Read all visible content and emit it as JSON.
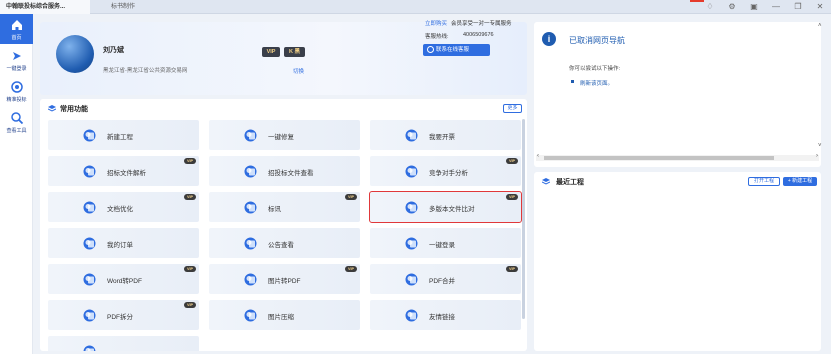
{
  "titlebar": {
    "tabs": [
      {
        "label": "中翰联投标综合服务..."
      },
      {
        "label": "标书制作"
      }
    ],
    "icons": [
      "bell-icon",
      "gear-icon",
      "screenshot-icon",
      "minimize-icon",
      "restore-icon",
      "close-icon"
    ],
    "icon_glyphs": [
      "♢",
      "⚙",
      "▣",
      "—",
      "❐",
      "✕"
    ]
  },
  "nav": {
    "items": [
      {
        "label": "首页",
        "active": true,
        "icon": "home-icon"
      },
      {
        "label": "一键登录",
        "active": false,
        "icon": "login-icon"
      },
      {
        "label": "精准投标",
        "active": false,
        "icon": "target-icon"
      },
      {
        "label": "查看工具",
        "active": false,
        "icon": "search-icon"
      }
    ]
  },
  "user": {
    "name": "刘乃斌",
    "org": "黑龙江省-黑龙江省公共资源交易网",
    "vip_label": "VIP",
    "k_label": "K 黑",
    "switch_label": "切换",
    "buy_now": "立即购买",
    "buy_text": "会员享受一对一专属服务",
    "hotline_label": "客服热线:",
    "hotline_number": "4006509676",
    "contact_button": "联系在线客服"
  },
  "functions": {
    "title": "常用功能",
    "more_label": "更多",
    "vip_text": "VIP",
    "items": [
      {
        "label": "新建工程",
        "vip": false
      },
      {
        "label": "一键修复",
        "vip": false
      },
      {
        "label": "我要开票",
        "vip": false
      },
      {
        "label": "招标文件解析",
        "vip": true
      },
      {
        "label": "招投标文件查看",
        "vip": false
      },
      {
        "label": "竞争对手分析",
        "vip": true
      },
      {
        "label": "文档优化",
        "vip": true
      },
      {
        "label": "标讯",
        "vip": true
      },
      {
        "label": "多版本文件比对",
        "vip": true,
        "highlighted": true
      },
      {
        "label": "我的订单",
        "vip": false
      },
      {
        "label": "公告查看",
        "vip": false
      },
      {
        "label": "一键登录",
        "vip": false
      },
      {
        "label": "Word转PDF",
        "vip": true
      },
      {
        "label": "图片转PDF",
        "vip": true
      },
      {
        "label": "PDF合并",
        "vip": true
      },
      {
        "label": "PDF拆分",
        "vip": true
      },
      {
        "label": "图片压缩",
        "vip": false
      },
      {
        "label": "友情链接",
        "vip": false
      },
      {
        "label": "",
        "vip": false
      }
    ]
  },
  "browser_panel": {
    "title": "已取消网页导航",
    "subtitle": "你可以尝试以下操作:",
    "link": "刷新该页面。"
  },
  "recent": {
    "title": "最近工程",
    "open_label": "打开工程",
    "new_label": "+ 新建工程"
  },
  "colors": {
    "accent": "#2f6de0",
    "highlight_border": "#e0383a",
    "vip_bg": "#3b3b3b",
    "vip_text": "#f3d28e"
  }
}
